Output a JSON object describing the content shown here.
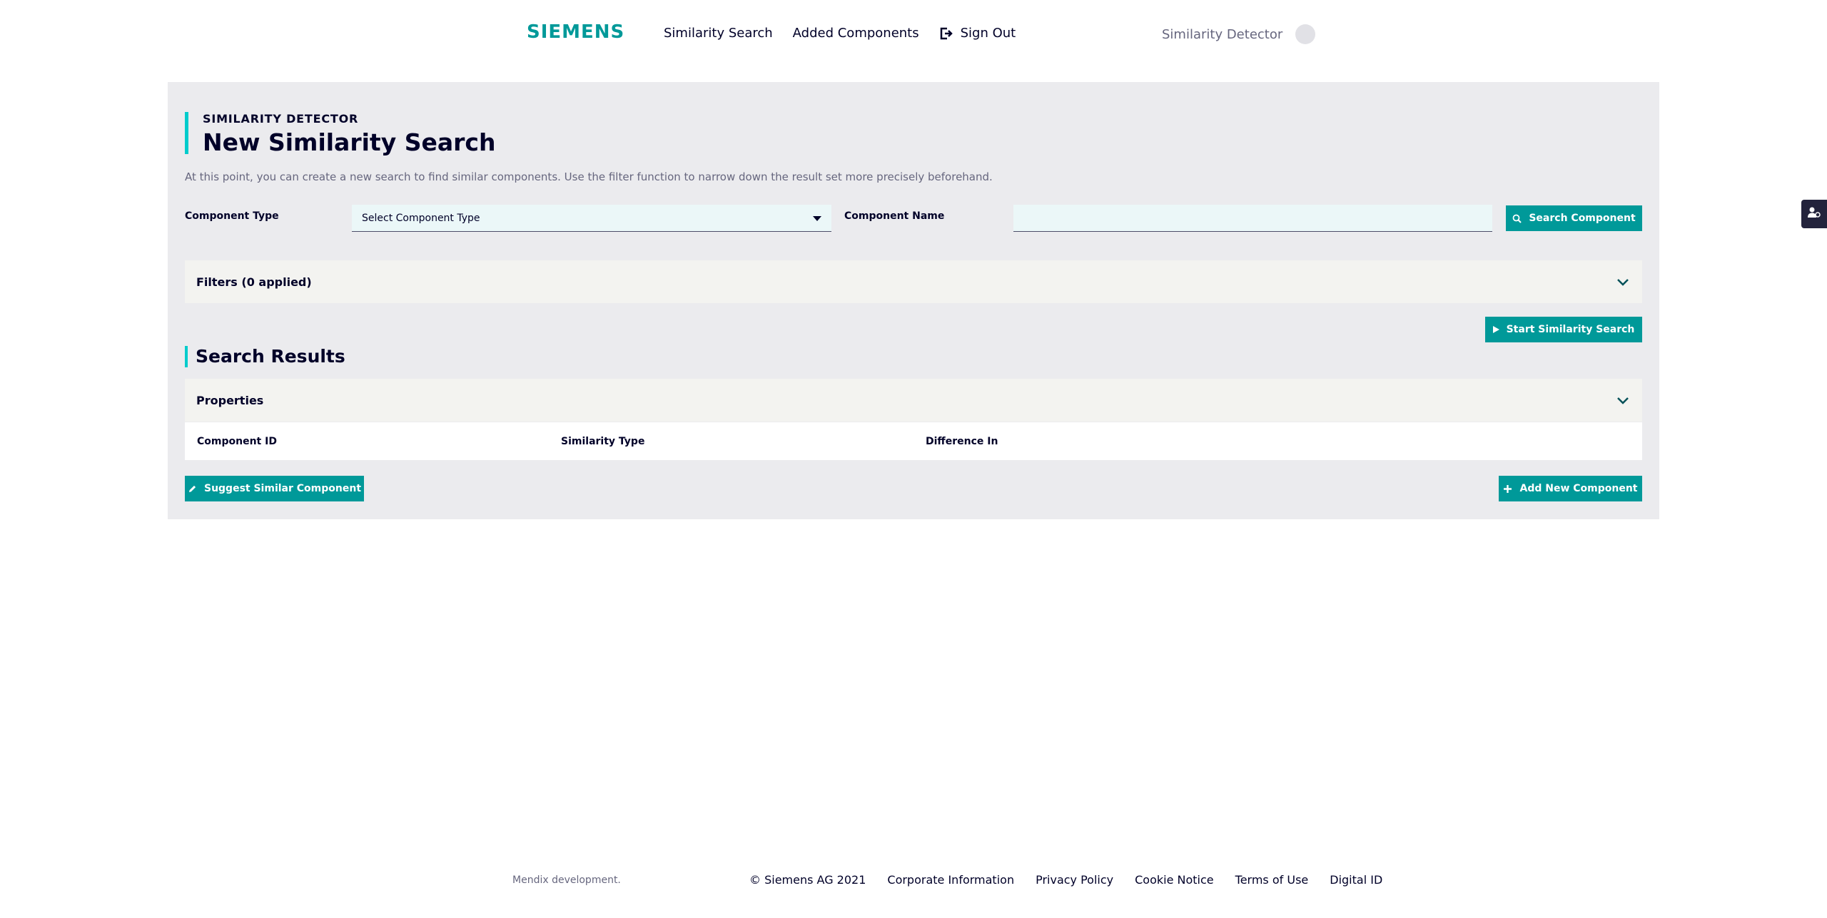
{
  "header": {
    "logo": "SIEMENS",
    "nav": {
      "similarity_search": "Similarity Search",
      "added_components": "Added Components",
      "sign_out": "Sign Out"
    },
    "user_name": "Similarity Detector"
  },
  "main": {
    "eyebrow": "SIMILARITY DETECTOR",
    "title": "New Similarity Search",
    "intro": "At this point, you can create a new search to find similar components. Use the filter function to narrow down the result set more precisely beforehand.",
    "component_type_label": "Component Type",
    "component_type_value": "Select Component Type",
    "component_name_label": "Component Name",
    "component_name_value": "",
    "search_button": "Search Component",
    "filters_label": "Filters (0 applied)",
    "start_button": "Start Similarity Search",
    "results_title": "Search Results",
    "properties_label": "Properties",
    "columns": [
      "Component ID",
      "Similarity Type",
      "Difference In"
    ],
    "suggest_button": "Suggest Similar Component",
    "add_button": "Add New Component"
  },
  "footer": {
    "note": "Mendix development.",
    "copyright": "© Siemens AG 2021",
    "links": [
      "Corporate Information",
      "Privacy Policy",
      "Cookie Notice",
      "Terms of Use",
      "Digital ID"
    ]
  },
  "colors": {
    "accent": "#009999",
    "accent_light": "#00cccc",
    "text": "#000028",
    "panel": "#ebebee"
  }
}
